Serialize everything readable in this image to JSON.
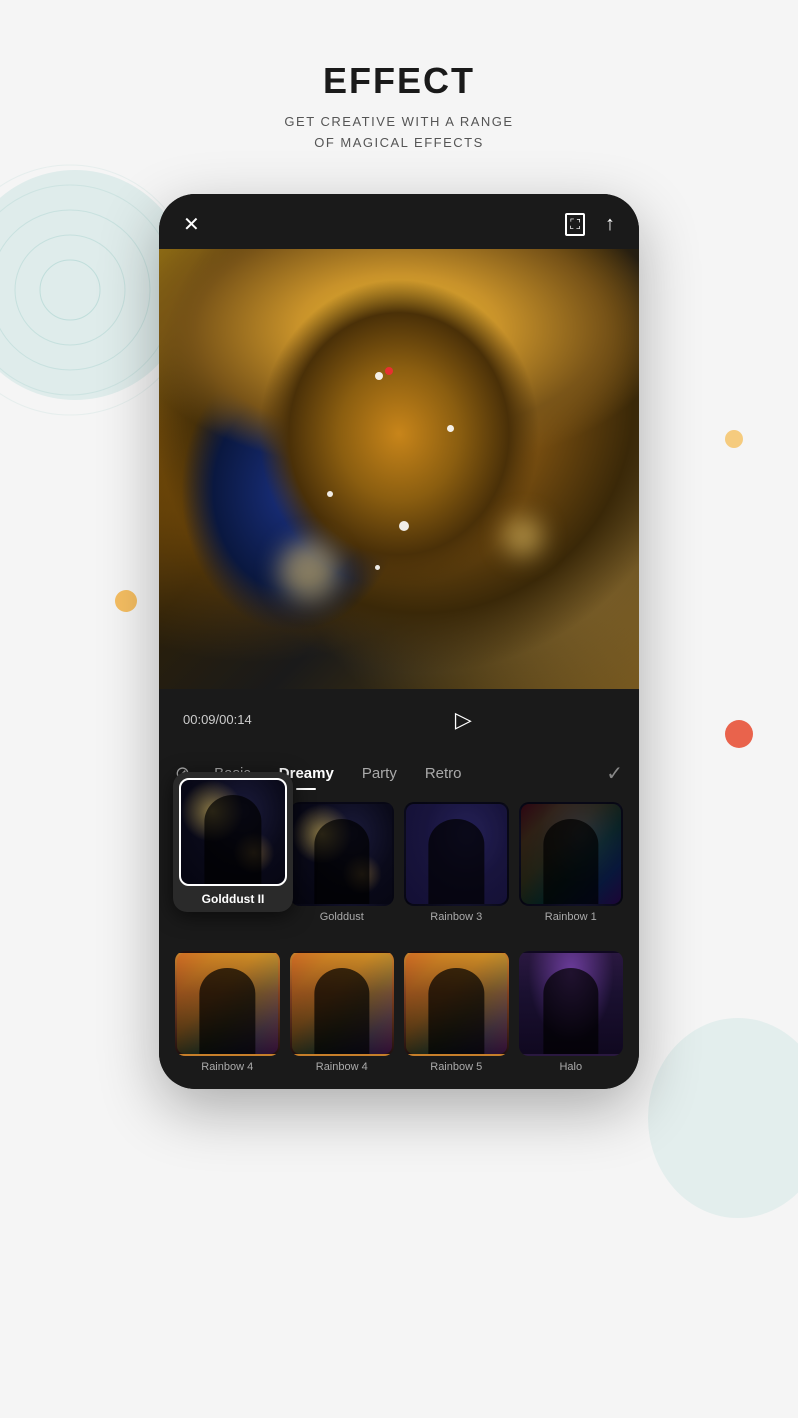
{
  "page": {
    "title": "EFFECT",
    "subtitle": "GET CREATIVE WITH A RANGE\nOF MAGICAL EFFECTS"
  },
  "topbar": {
    "close_icon": "✕",
    "expand_icon": "⛶",
    "share_icon": "↑"
  },
  "player": {
    "time": "00:09/00:14",
    "play_icon": "▷"
  },
  "tabs": [
    {
      "id": "filter",
      "label": "",
      "icon": "⊘",
      "active": false
    },
    {
      "id": "basic",
      "label": "Basic",
      "active": false
    },
    {
      "id": "dreamy",
      "label": "Dreamy",
      "active": true
    },
    {
      "id": "party",
      "label": "Party",
      "active": false
    },
    {
      "id": "retro",
      "label": "Retro",
      "active": false
    }
  ],
  "check_icon": "✓",
  "effects_row1": [
    {
      "id": "golddust2",
      "label": "Golddust II",
      "type": "golddust2",
      "selected": true,
      "large": true
    },
    {
      "id": "golddust",
      "label": "Golddust",
      "type": "golddust",
      "selected": false,
      "large": false
    },
    {
      "id": "rainbow3",
      "label": "Rainbow 3",
      "type": "rainbow3",
      "selected": false,
      "large": false
    },
    {
      "id": "rainbow1",
      "label": "Rainbow 1",
      "type": "rainbow1",
      "selected": false,
      "large": false
    }
  ],
  "effects_row2": [
    {
      "id": "rainbow4a",
      "label": "Rainbow 4",
      "type": "rainbow4a",
      "selected": false
    },
    {
      "id": "rainbow4b",
      "label": "Rainbow 4",
      "type": "rainbow4b",
      "selected": false
    },
    {
      "id": "rainbow5",
      "label": "Rainbow 5",
      "type": "rainbow5",
      "selected": false
    },
    {
      "id": "halo",
      "label": "Halo",
      "type": "halo",
      "selected": false
    }
  ]
}
